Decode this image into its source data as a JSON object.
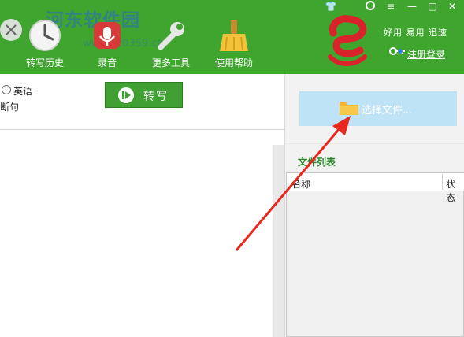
{
  "app": {
    "watermark": "河东软件园",
    "watermark_url": "www.pc0359.cn"
  },
  "toolbar": {
    "items": [
      {
        "label": "转写历史",
        "icon": "clock-icon"
      },
      {
        "label": "录音",
        "icon": "microphone-icon"
      },
      {
        "label": "更多工具",
        "icon": "wrench-icon"
      },
      {
        "label": "使用帮助",
        "icon": "broom-icon"
      }
    ]
  },
  "window_controls": {
    "skin": "👕",
    "menu": "≡",
    "minimize": "—",
    "maximize": "□",
    "close": "✕"
  },
  "brand": {
    "slogan": "好用 易用 迅速",
    "register_label": "注册登录"
  },
  "options": {
    "language_english": "英语",
    "sentence_option": "断句"
  },
  "convert_button": {
    "label": "转写"
  },
  "file_panel": {
    "select_button_label": "选择文件...",
    "list_title": "文件列表",
    "columns": [
      "名称",
      "状态"
    ]
  },
  "colors": {
    "header_green": "#3fa52f",
    "select_button_bg": "#bfe3f6",
    "arrow_red": "#e8281e"
  }
}
